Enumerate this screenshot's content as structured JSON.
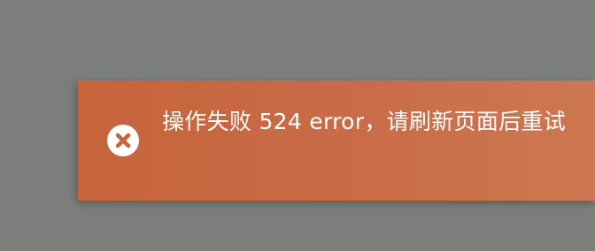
{
  "toast": {
    "type": "error",
    "icon": "close-circle-icon",
    "message": "操作失败 524 error，请刷新页面后重试",
    "background_color": "#c96c47",
    "text_color": "#ffffff"
  },
  "backdrop": {
    "color": "#7c7e7c"
  }
}
